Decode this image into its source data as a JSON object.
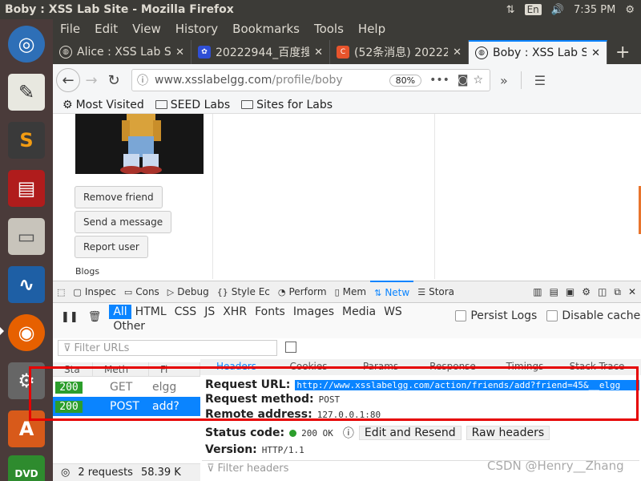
{
  "window": {
    "title": "Boby : XSS Lab Site - Mozilla Firefox"
  },
  "tray": {
    "lang": "En",
    "time": "7:35 PM"
  },
  "menu": [
    "File",
    "Edit",
    "View",
    "History",
    "Bookmarks",
    "Tools",
    "Help"
  ],
  "tabs": [
    {
      "label": "Alice : XSS Lab Sit",
      "favicon": "globe-icon"
    },
    {
      "label": "20222944_百度搜",
      "favicon": "baidu-icon"
    },
    {
      "label": "(52条消息) 20222",
      "favicon": "csdn-icon",
      "fav_text": "C"
    },
    {
      "label": "Boby : XSS Lab Sit",
      "favicon": "globe-icon",
      "active": true
    }
  ],
  "newtab": "+",
  "nav": {
    "url_host": "www.xsslabelgg.com",
    "url_path": "/profile/boby",
    "zoom": "80%"
  },
  "bookmarks": [
    "Most Visited",
    "SEED Labs",
    "Sites for Labs"
  ],
  "profile": {
    "buttons": [
      "Remove friend",
      "Send a message",
      "Report user"
    ],
    "blogs_label": "Blogs"
  },
  "devtools": {
    "tabs": [
      "Inspec",
      "Cons",
      "Debug",
      "Style Ec",
      "Perform",
      "Mem",
      "Netw",
      "Stora"
    ],
    "active_tab": "Netw",
    "filter_types": [
      "All",
      "HTML",
      "CSS",
      "JS",
      "XHR",
      "Fonts",
      "Images",
      "Media",
      "WS",
      "Other"
    ],
    "persist_logs": "Persist Logs",
    "disable_cache": "Disable cache",
    "filter_placeholder": "Filter URLs",
    "columns": [
      "Sta",
      "Meth",
      "Fi"
    ],
    "requests": [
      {
        "status": "200",
        "method": "GET",
        "file": "elgg"
      },
      {
        "status": "200",
        "method": "POST",
        "file": "add?",
        "selected": true
      }
    ],
    "detail_tabs": [
      "Headers",
      "Cookies",
      "Params",
      "Response",
      "Timings",
      "Stack Trace"
    ],
    "detail": {
      "request_url_label": "Request URL:",
      "request_url": "http://www.xsslabelgg.com/action/friends/add?friend=45&__elgg",
      "request_method_label": "Request method:",
      "request_method": "POST",
      "remote_address_label": "Remote address:",
      "remote_address": "127.0.0.1:80",
      "status_code_label": "Status code:",
      "status_code": "200 OK",
      "edit_resend": "Edit and Resend",
      "raw_headers": "Raw headers",
      "version_label": "Version:",
      "version": "HTTP/1.1",
      "filter_headers": "Filter headers"
    },
    "summary": {
      "requests": "2 requests",
      "size": "58.39 K"
    }
  },
  "watermark": "CSDN @Henry__Zhang",
  "colors": {
    "accent": "#0a84ff",
    "ok": "#2c9e2c",
    "annotation": "#e60000"
  }
}
